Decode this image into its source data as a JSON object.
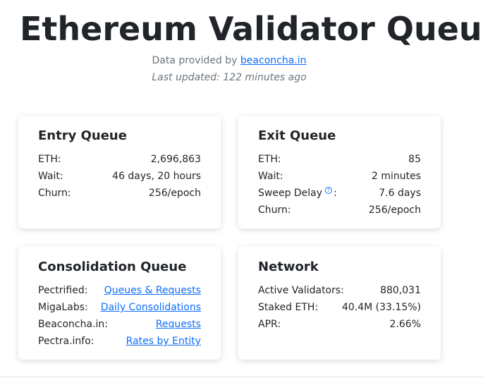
{
  "header": {
    "title": "Ethereum Validator Queue",
    "provided_prefix": "Data provided by ",
    "provided_link": "beaconcha.in",
    "last_updated": "Last updated: 122 minutes ago"
  },
  "entry_queue": {
    "title": "Entry Queue",
    "rows": [
      {
        "label": "ETH:",
        "value": "2,696,863"
      },
      {
        "label": "Wait:",
        "value": "46 days, 20 hours"
      },
      {
        "label": "Churn:",
        "value": "256/epoch"
      }
    ]
  },
  "exit_queue": {
    "title": "Exit Queue",
    "rows": [
      {
        "label": "ETH:",
        "value": "85"
      },
      {
        "label": "Wait:",
        "value": "2 minutes"
      },
      {
        "label": "Sweep Delay",
        "value": "7.6 days",
        "colon": ":",
        "info_icon": "?"
      },
      {
        "label": "Churn:",
        "value": "256/epoch"
      }
    ]
  },
  "consolidation_queue": {
    "title": "Consolidation Queue",
    "rows": [
      {
        "label": "Pectrified:",
        "value": "Queues & Requests"
      },
      {
        "label": "MigaLabs:",
        "value": "Daily Consolidations"
      },
      {
        "label": "Beaconcha.in:",
        "value": "Requests"
      },
      {
        "label": "Pectra.info:",
        "value": "Rates by Entity"
      }
    ]
  },
  "network": {
    "title": "Network",
    "rows": [
      {
        "label": "Active Validators:",
        "value": "880,031"
      },
      {
        "label": "Staked ETH:",
        "value": "40.4M (33.15%)"
      },
      {
        "label": "APR:",
        "value": "2.66%"
      }
    ]
  },
  "colors": {
    "link": "#0d6efd",
    "muted": "#6c757d",
    "text": "#212529"
  }
}
